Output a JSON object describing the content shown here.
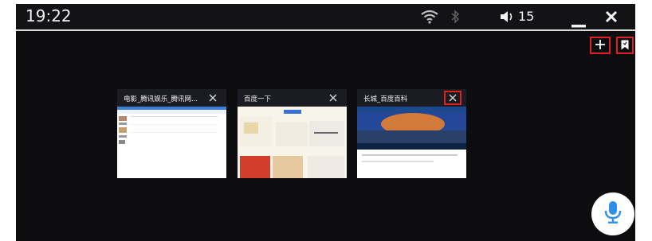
{
  "status_bar": {
    "time": "19:22",
    "volume_level": "15",
    "icons": [
      "wifi-icon",
      "bluetooth-icon",
      "volume-icon",
      "minimize-icon",
      "close-icon"
    ]
  },
  "toolbar": {
    "new_tab_icon": "plus-icon",
    "bookmarks_icon": "bookmark-icon"
  },
  "tabs": [
    {
      "title": "电影_腾讯娱乐_腾讯网..."
    },
    {
      "title": "百度一下"
    },
    {
      "title": "长城_百度百科"
    }
  ],
  "voice_button_icon": "microphone-icon",
  "colors": {
    "background": "#0d0d0f",
    "highlight_border": "#e02020",
    "mic_blue": "#2f8fe6",
    "tab_header": "#1b1c21"
  }
}
